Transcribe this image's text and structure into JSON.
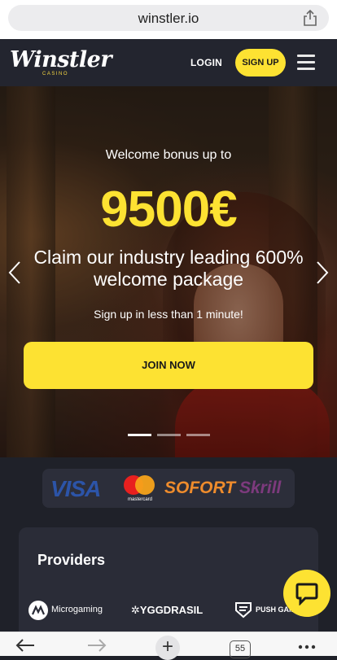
{
  "browser": {
    "url": "winstler.io",
    "tabs_count": "55"
  },
  "header": {
    "logo_text": "Winstler",
    "logo_sub": "CASINO",
    "login_label": "LOGIN",
    "signup_label": "SIGN UP"
  },
  "hero": {
    "subtitle": "Welcome bonus up to",
    "amount": "9500€",
    "headline": "Claim our industry leading 600% welcome package",
    "small_text": "Sign up in less than 1 minute!",
    "cta_label": "JOIN NOW",
    "slides_total": 3,
    "active_slide": 1
  },
  "payments": {
    "items": [
      "VISA",
      "mastercard",
      "SOFORT",
      "Skrill"
    ]
  },
  "providers": {
    "title": "Providers",
    "items": [
      "Microgaming",
      "YGGDRASIL",
      "PUSH GAM"
    ]
  },
  "colors": {
    "accent": "#fde232",
    "background": "#1f2129",
    "header": "#23252f",
    "card": "#2a2c37"
  }
}
